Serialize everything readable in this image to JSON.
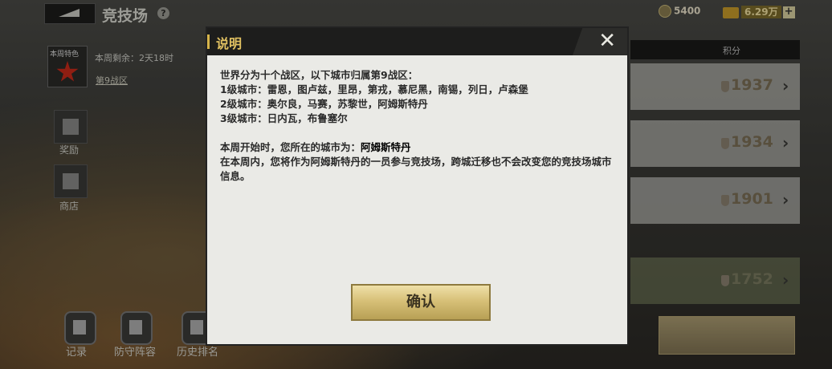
{
  "topbar": {
    "title": "竞技场",
    "currency_1": "5400",
    "currency_2": "6.29万",
    "plus": "+"
  },
  "left": {
    "season_label": "本周特色",
    "remaining": "本周剩余：2天18时",
    "zone_link": "第9战区",
    "reward_label": "奖励",
    "shop_label": "商店"
  },
  "bottom": {
    "records": "记录",
    "defense": "防守阵容",
    "history": "历史排名"
  },
  "list": {
    "header_score": "积分",
    "scores": [
      "1937",
      "1934",
      "1901",
      "1752"
    ]
  },
  "dialog": {
    "title": "说明",
    "close": "✕",
    "line1": "世界分为十个战区，以下城市归属第9战区：",
    "line2": "1级城市：雷恩，图卢兹，里昂，第戎，慕尼黑，南锡，列日，卢森堡",
    "line3": "2级城市：奥尔良，马赛，苏黎世，阿姆斯特丹",
    "line4": "3级城市：日内瓦，布鲁塞尔",
    "line5_prefix": "本周开始时，您所在的城市为：",
    "line5_city": "阿姆斯特丹",
    "line6": "在本周内，您将作为阿姆斯特丹的一员参与竞技场，跨城迁移也不会改变您的竞技场城市信息。",
    "confirm": "确认"
  }
}
